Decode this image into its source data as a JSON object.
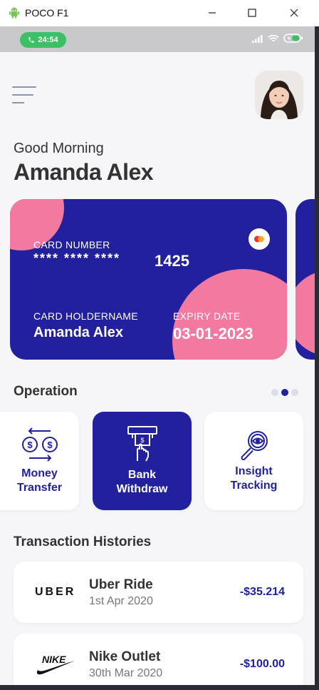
{
  "window": {
    "title": "POCO F1",
    "minimize_icon": "minimize-icon",
    "maximize_icon": "maximize-icon",
    "close_icon": "close-icon"
  },
  "status_bar": {
    "time": "24:54"
  },
  "header": {
    "greeting": "Good Morning",
    "name": "Amanda Alex"
  },
  "card": {
    "number_label": "CARD NUMBER",
    "masked_number": "**** **** ****",
    "last_digits": "1425",
    "holder_label": "CARD HOLDERNAME",
    "holder_name": "Amanda Alex",
    "expiry_label": "EXPIRY DATE",
    "expiry_date": "03-01-2023",
    "colors": {
      "card": "#22209c",
      "accent": "#f27aa0"
    }
  },
  "operation": {
    "title": "Operation",
    "items": [
      {
        "label": "Money\nTransfer",
        "icon": "money-transfer-icon"
      },
      {
        "label": "Bank\nWithdraw",
        "icon": "atm-withdraw-icon",
        "active": true
      },
      {
        "label": "Insight\nTracking",
        "icon": "insight-tracking-icon"
      }
    ]
  },
  "transactions": {
    "title": "Transaction Histories",
    "items": [
      {
        "logo_text": "UBER",
        "name": "Uber Ride",
        "date": "1st Apr 2020",
        "amount": "-$35.214"
      },
      {
        "logo_text": "NIKE",
        "name": "Nike Outlet",
        "date": "30th Mar 2020",
        "amount": "-$100.00"
      }
    ]
  }
}
